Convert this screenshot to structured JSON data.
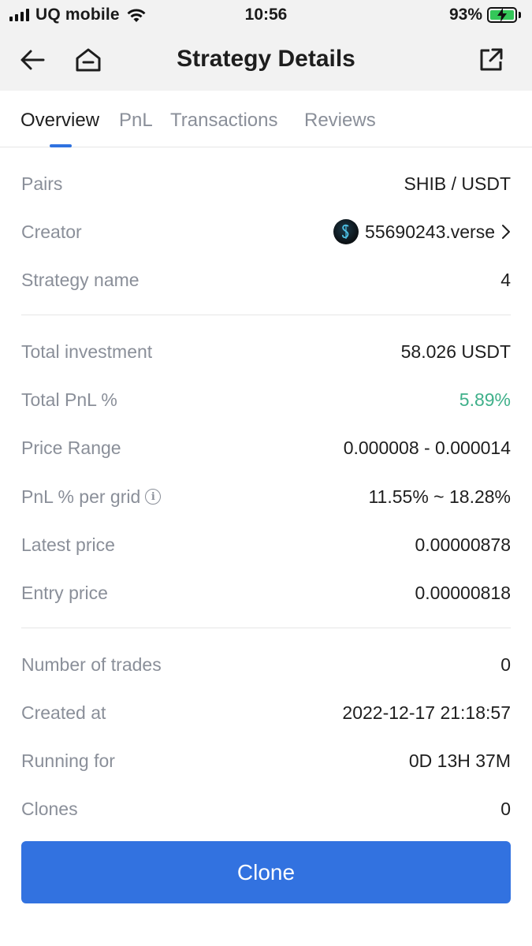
{
  "status_bar": {
    "carrier": "UQ mobile",
    "time": "10:56",
    "battery": "93%"
  },
  "nav": {
    "title": "Strategy Details"
  },
  "tabs": [
    {
      "label": "Overview",
      "active": true
    },
    {
      "label": "PnL"
    },
    {
      "label": "Transactions"
    },
    {
      "label": "Reviews"
    }
  ],
  "details": {
    "pairs": {
      "label": "Pairs",
      "value": "SHIB / USDT"
    },
    "creator": {
      "label": "Creator",
      "value": "55690243.verse"
    },
    "strategy_name": {
      "label": "Strategy name",
      "value": "4"
    },
    "total_investment": {
      "label": "Total investment",
      "value": "58.026 USDT"
    },
    "total_pnl": {
      "label": "Total PnL %",
      "value": "5.89%"
    },
    "price_range": {
      "label": "Price Range",
      "value": "0.000008 - 0.000014"
    },
    "pnl_per_grid": {
      "label": "PnL % per grid",
      "value": "11.55% ~ 18.28%"
    },
    "latest_price": {
      "label": "Latest price",
      "value": "0.00000878"
    },
    "entry_price": {
      "label": "Entry price",
      "value": "0.00000818"
    },
    "number_of_trades": {
      "label": "Number of trades",
      "value": "0"
    },
    "created_at": {
      "label": "Created at",
      "value": "2022-12-17 21:18:57"
    },
    "running_for": {
      "label": "Running for",
      "value": "0D 13H 37M"
    },
    "clones": {
      "label": "Clones",
      "value": "0"
    }
  },
  "actions": {
    "clone_label": "Clone"
  },
  "colors": {
    "accent": "#3272e0",
    "positive": "#3fb08a",
    "label_gray": "#8a8f99"
  }
}
